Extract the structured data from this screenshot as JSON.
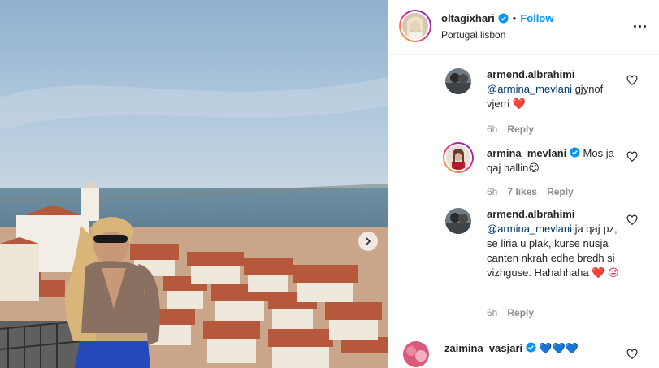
{
  "post": {
    "username": "oltagixhari",
    "follow_label": "Follow",
    "dot": "•",
    "location": "Portugal,lisbon"
  },
  "comments": [
    {
      "username": "armend.albrahimi",
      "mention": "@armina_mevlani",
      "text": " gjynof vjerri ",
      "emoji": "❤️",
      "time": "6h",
      "reply_label": "Reply"
    },
    {
      "username": "armina_mevlani",
      "verified": true,
      "text": " Mos ja qaj hallin",
      "emoji": "😉",
      "time": "6h",
      "likes": "7 likes",
      "reply_label": "Reply"
    },
    {
      "username": "armend.albrahimi",
      "mention": "@armina_mevlani",
      "text": " ja qaj pz, se liria u plak, kurse nusja canten nkrah edhe bredh si vizhguse. Hahahhaha ",
      "emoji": "❤️ 😜",
      "time": "6h",
      "reply_label": "Reply"
    },
    {
      "username": "zaimina_vasjari",
      "verified": true,
      "text": " 💙💙💙"
    }
  ],
  "colors": {
    "accent": "#0095f6",
    "mention": "#00376b",
    "muted": "#8e8e8e",
    "heart": "#ed4956"
  },
  "icons": [
    "verified-badge-icon",
    "more-options-icon",
    "heart-outline-icon",
    "chevron-right-icon"
  ]
}
